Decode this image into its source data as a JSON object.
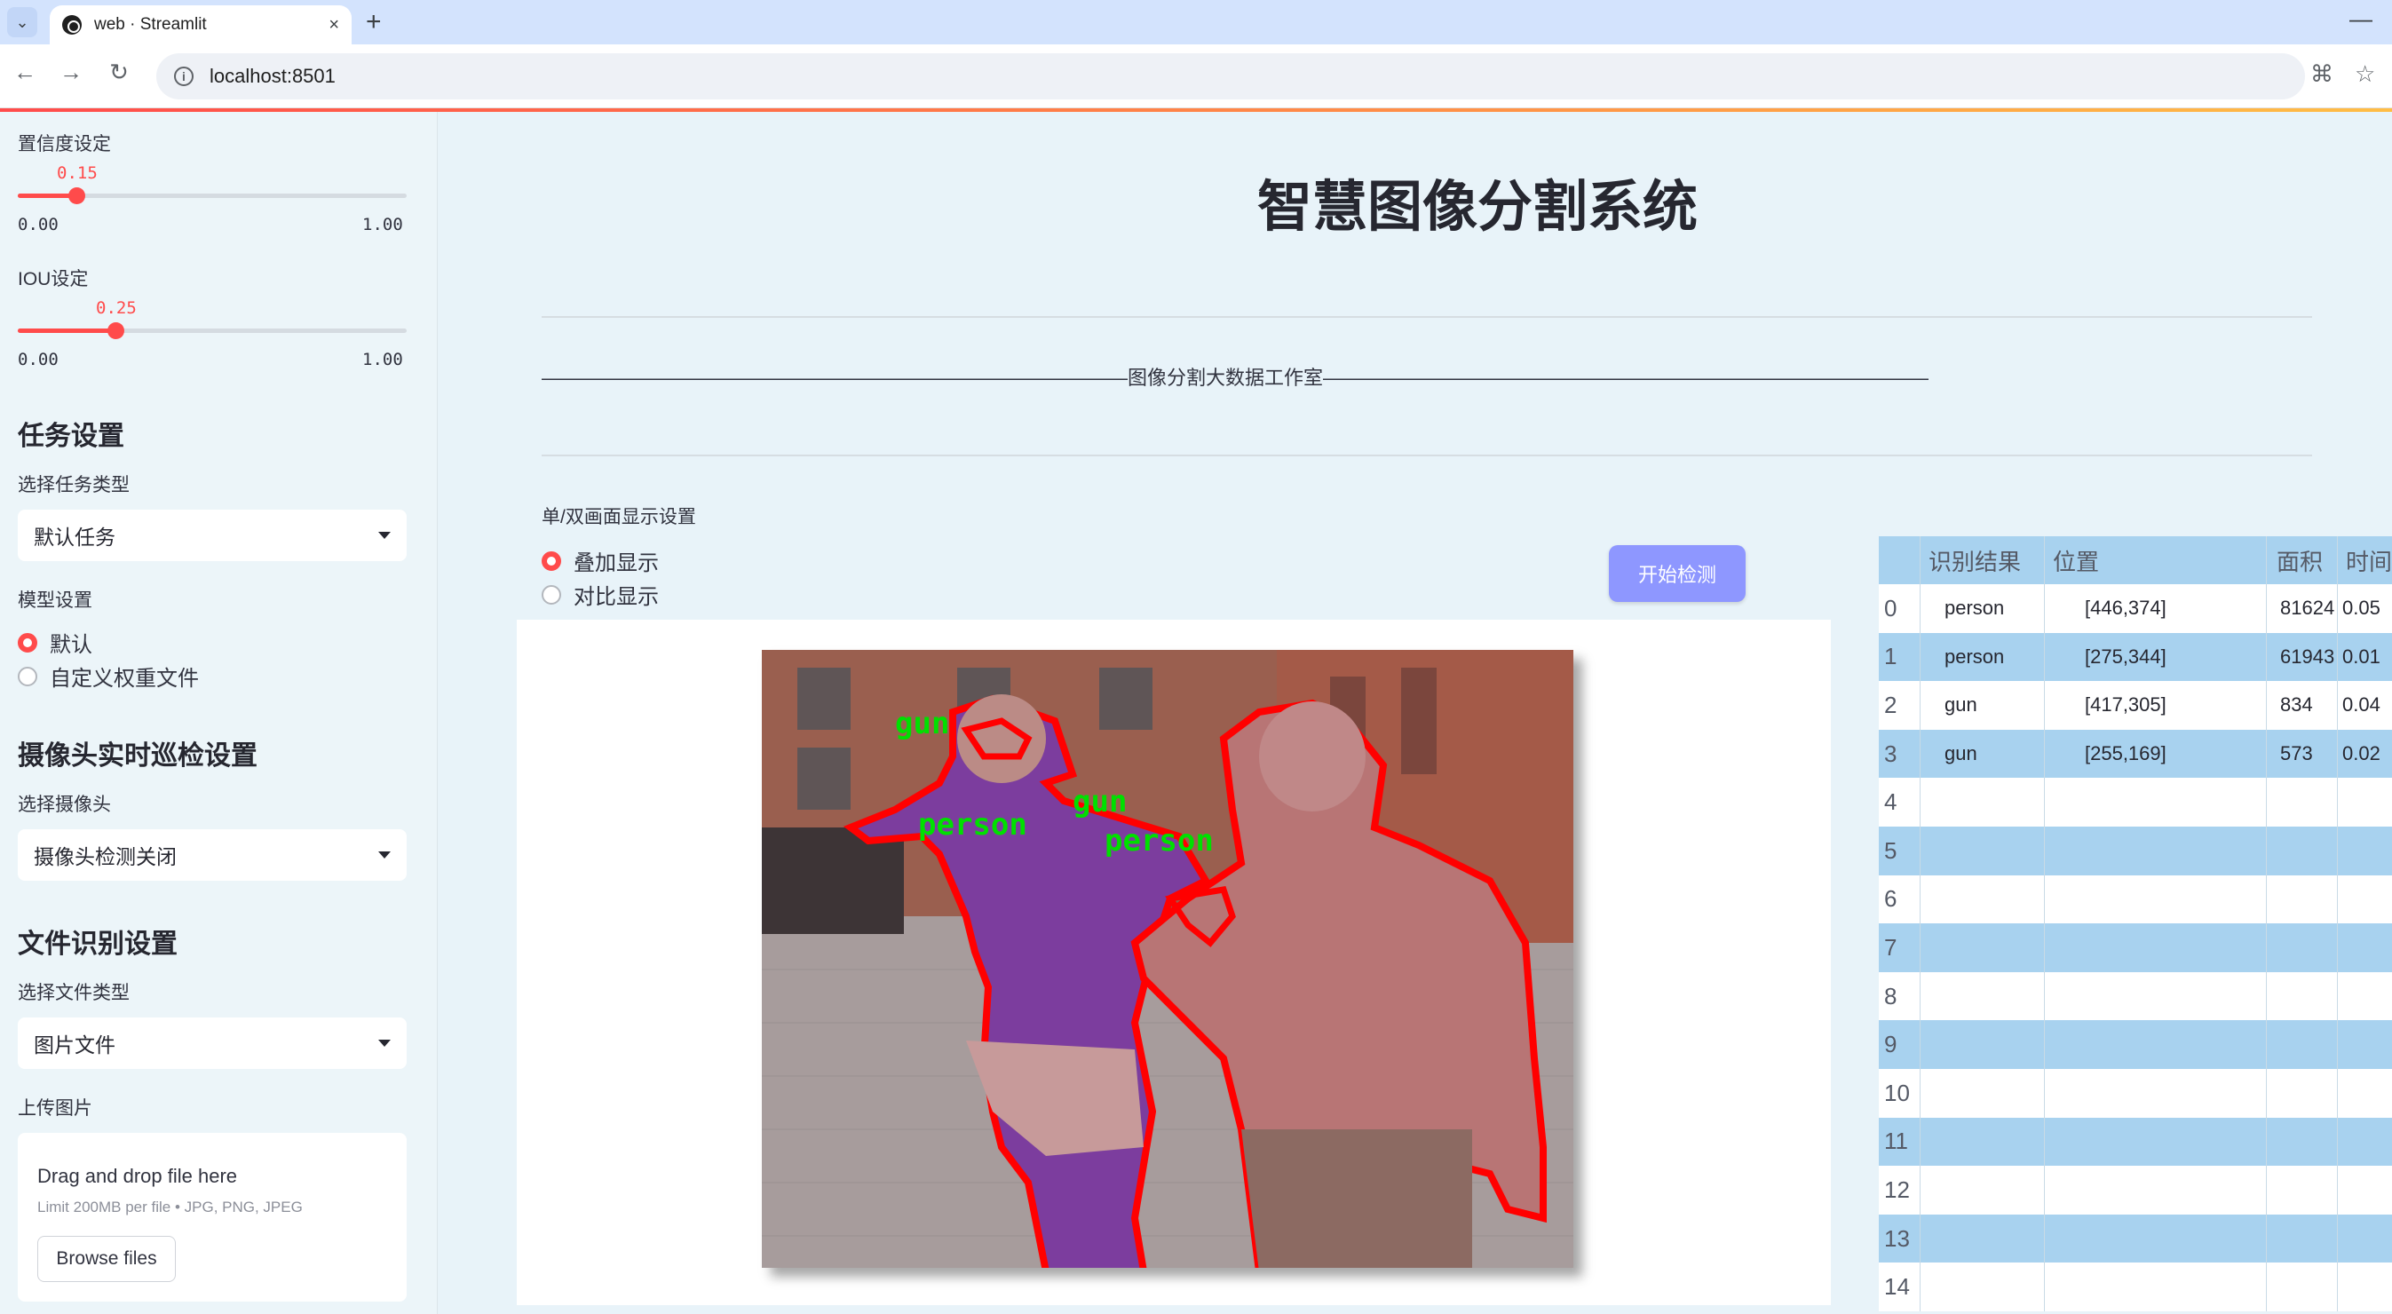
{
  "browser": {
    "tab_title": "web · Streamlit",
    "new_tab": "+",
    "close": "×",
    "url": "localhost:8501"
  },
  "sidebar": {
    "confidence": {
      "label": "置信度设定",
      "value": "0.15",
      "level": 0.15,
      "min": "0.00",
      "max": "1.00"
    },
    "iou": {
      "label": "IOU设定",
      "value": "0.25",
      "level": 0.25,
      "min": "0.00",
      "max": "1.00"
    },
    "task_header": "任务设置",
    "task_type_label": "选择任务类型",
    "task_type_value": "默认任务",
    "model_label": "模型设置",
    "model_options": [
      "默认",
      "自定义权重文件"
    ],
    "model_selected": 0,
    "camera_header": "摄像头实时巡检设置",
    "camera_label": "选择摄像头",
    "camera_value": "摄像头检测关闭",
    "file_header": "文件识别设置",
    "file_type_label": "选择文件类型",
    "file_type_value": "图片文件",
    "upload_label": "上传图片",
    "upload_title": "Drag and drop file here",
    "upload_limit": "Limit 200MB per file • JPG, PNG, JPEG",
    "browse_label": "Browse files"
  },
  "main": {
    "title": "智慧图像分割系统",
    "studio_line": "——————————————————————————————图像分割大数据工作室———————————————————————————————",
    "display_label": "单/双画面显示设置",
    "display_options": [
      "叠加显示",
      "对比显示"
    ],
    "display_selected": 0,
    "detect_button": "开始检测",
    "image_labels": [
      "gun",
      "person",
      "gun",
      "person"
    ]
  },
  "table": {
    "columns": [
      "识别结果",
      "位置",
      "面积",
      "时间"
    ],
    "rows": [
      {
        "idx": "0",
        "result": "person",
        "pos": "[446,374]",
        "area": "81624",
        "time": "0.05"
      },
      {
        "idx": "1",
        "result": "person",
        "pos": "[275,344]",
        "area": "61943",
        "time": "0.01"
      },
      {
        "idx": "2",
        "result": "gun",
        "pos": "[417,305]",
        "area": "834",
        "time": "0.04"
      },
      {
        "idx": "3",
        "result": "gun",
        "pos": "[255,169]",
        "area": "573",
        "time": "0.02"
      },
      {
        "idx": "4",
        "result": "",
        "pos": "",
        "area": "",
        "time": ""
      },
      {
        "idx": "5",
        "result": "",
        "pos": "",
        "area": "",
        "time": ""
      },
      {
        "idx": "6",
        "result": "",
        "pos": "",
        "area": "",
        "time": ""
      },
      {
        "idx": "7",
        "result": "",
        "pos": "",
        "area": "",
        "time": ""
      },
      {
        "idx": "8",
        "result": "",
        "pos": "",
        "area": "",
        "time": ""
      },
      {
        "idx": "9",
        "result": "",
        "pos": "",
        "area": "",
        "time": ""
      },
      {
        "idx": "10",
        "result": "",
        "pos": "",
        "area": "",
        "time": ""
      },
      {
        "idx": "11",
        "result": "",
        "pos": "",
        "area": "",
        "time": ""
      },
      {
        "idx": "12",
        "result": "",
        "pos": "",
        "area": "",
        "time": ""
      },
      {
        "idx": "13",
        "result": "",
        "pos": "",
        "area": "",
        "time": ""
      },
      {
        "idx": "14",
        "result": "",
        "pos": "",
        "area": "",
        "time": ""
      }
    ]
  },
  "colors": {
    "accent": "#ff4b4b",
    "button": "#8e97ff",
    "table_stripe": "#a8d2ef",
    "mask_outline": "#ff0000",
    "label_text": "#00e000"
  }
}
